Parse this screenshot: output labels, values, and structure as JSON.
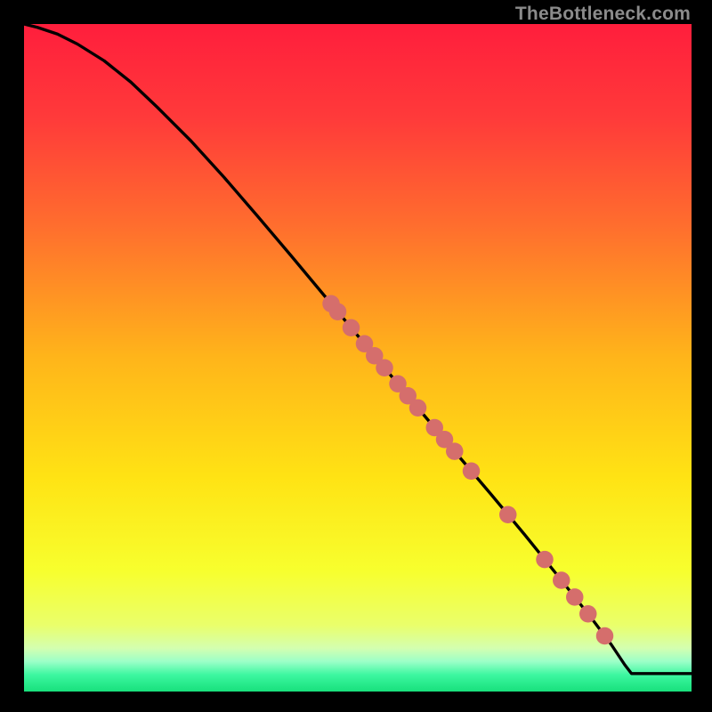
{
  "watermark": "TheBottleneck.com",
  "colors": {
    "gradient_stops": [
      {
        "pct": 0,
        "color": "#ff1e3c"
      },
      {
        "pct": 14,
        "color": "#ff3a3a"
      },
      {
        "pct": 30,
        "color": "#ff6d2e"
      },
      {
        "pct": 50,
        "color": "#ffb51a"
      },
      {
        "pct": 68,
        "color": "#ffe314"
      },
      {
        "pct": 82,
        "color": "#f7ff2e"
      },
      {
        "pct": 90,
        "color": "#eaff6a"
      },
      {
        "pct": 93.5,
        "color": "#d4ffb0"
      },
      {
        "pct": 95.5,
        "color": "#9cffc8"
      },
      {
        "pct": 97.5,
        "color": "#3cf7a0"
      },
      {
        "pct": 100,
        "color": "#18e07c"
      }
    ],
    "curve": "#000000",
    "marker": "#d56e6c"
  },
  "chart_data": {
    "type": "line",
    "title": "",
    "xlabel": "",
    "ylabel": "",
    "xlim": [
      0,
      100
    ],
    "ylim": [
      0,
      100
    ],
    "series": [
      {
        "name": "curve",
        "x": [
          0,
          2,
          5,
          8,
          12,
          16,
          20,
          25,
          30,
          35,
          40,
          45,
          50,
          55,
          60,
          65,
          70,
          75,
          80,
          85,
          88,
          90,
          91,
          100
        ],
        "y": [
          100,
          99.5,
          98.5,
          97,
          94.5,
          91.3,
          87.5,
          82.5,
          77,
          71.2,
          65.3,
          59.3,
          53.3,
          47.3,
          41.3,
          35.4,
          29.5,
          23.5,
          17.3,
          11,
          7,
          4,
          2.7,
          2.7
        ]
      }
    ],
    "markers_on_curve_x": [
      46,
      47,
      49,
      51,
      52.5,
      54,
      56,
      57.5,
      59,
      61.5,
      63,
      64.5,
      67,
      72.5,
      78,
      80.5,
      82.5,
      84.5,
      87
    ],
    "marker_radius": 1.3
  }
}
